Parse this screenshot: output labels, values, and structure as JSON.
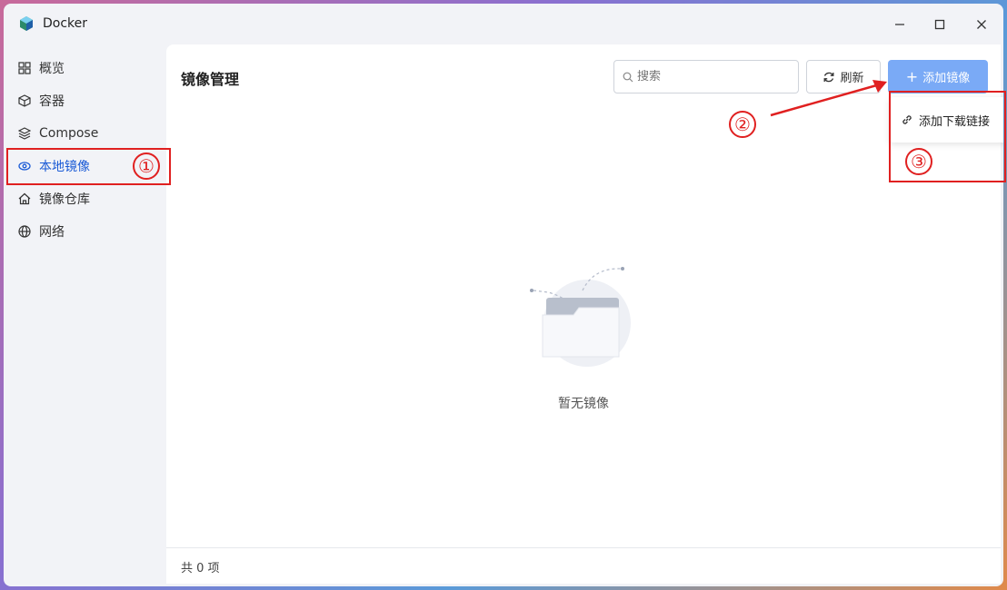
{
  "window": {
    "title": "Docker",
    "controls": [
      "minimize-icon",
      "maximize-icon",
      "close-icon"
    ]
  },
  "sidebar": {
    "items": [
      {
        "label": "概览",
        "icon": "grid-icon"
      },
      {
        "label": "容器",
        "icon": "cube-icon"
      },
      {
        "label": "Compose",
        "icon": "layers-icon"
      },
      {
        "label": "本地镜像",
        "icon": "eye-icon",
        "active": true
      },
      {
        "label": "镜像仓库",
        "icon": "house-icon"
      },
      {
        "label": "网络",
        "icon": "globe-icon"
      }
    ]
  },
  "main": {
    "title": "镜像管理",
    "search_placeholder": "搜索",
    "refresh_label": "刷新",
    "add_label": "添加镜像",
    "dropdown_item": "添加下载链接",
    "empty_text": "暂无镜像",
    "footer_text": "共 0 项"
  },
  "annotations": {
    "one": "①",
    "two": "②",
    "three": "③"
  },
  "colors": {
    "accent": "#1b5bd6",
    "primary_button": "#7aaaf6",
    "annotation": "#e02020"
  }
}
